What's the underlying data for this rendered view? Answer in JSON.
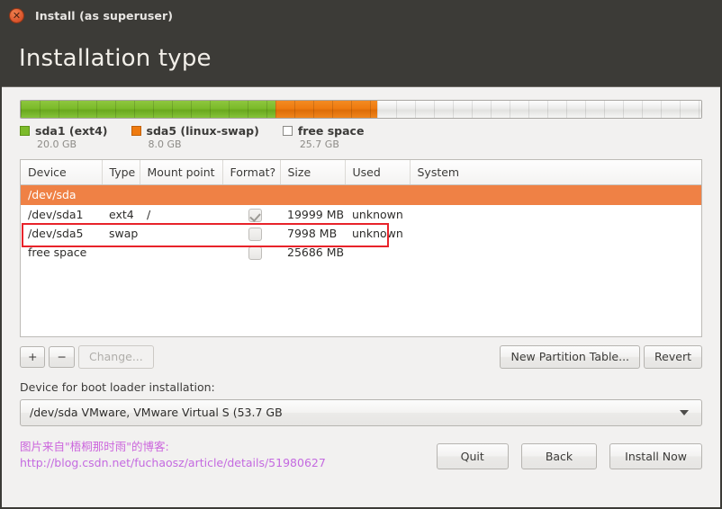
{
  "window": {
    "title": "Install (as superuser)",
    "close_icon": "close-icon",
    "close_glyph": "✕"
  },
  "page": {
    "heading": "Installation type"
  },
  "partition_bar": {
    "segments": [
      {
        "label": "sda1 (ext4)",
        "size": "20.0 GB",
        "color": "#7cbb2a",
        "percent": 37.4
      },
      {
        "label": "sda5 (linux-swap)",
        "size": "8.0 GB",
        "color": "#ef7b10",
        "percent": 15.0
      },
      {
        "label": "free space",
        "size": "25.7 GB",
        "color": "#ffffff",
        "percent": 47.6
      }
    ]
  },
  "table": {
    "columns": [
      "Device",
      "Type",
      "Mount point",
      "Format?",
      "Size",
      "Used",
      "System"
    ],
    "disk_row": "/dev/sda",
    "rows": [
      {
        "device": "/dev/sda1",
        "type": "ext4",
        "mount": "/",
        "format": true,
        "size": "19999 MB",
        "used": "unknown",
        "system": ""
      },
      {
        "device": "/dev/sda5",
        "type": "swap",
        "mount": "",
        "format": false,
        "size": "7998 MB",
        "used": "unknown",
        "system": ""
      },
      {
        "device": "free space",
        "type": "",
        "mount": "",
        "format": false,
        "size": "25686 MB",
        "used": "",
        "system": ""
      }
    ],
    "highlight_color": "#e8232a"
  },
  "toolbar": {
    "add_label": "+",
    "remove_label": "−",
    "change_label": "Change...",
    "new_table_label": "New Partition Table...",
    "revert_label": "Revert"
  },
  "bootloader": {
    "label": "Device for boot loader installation:",
    "value": "/dev/sda   VMware, VMware Virtual S (53.7 GB"
  },
  "watermark": {
    "line1": "图片来自\"梧桐那时雨\"的博客:",
    "line2": "http://blog.csdn.net/fuchaosz/article/details/51980627",
    "color": "#cc66dd"
  },
  "footer": {
    "quit_label": "Quit",
    "back_label": "Back",
    "install_label": "Install Now"
  }
}
